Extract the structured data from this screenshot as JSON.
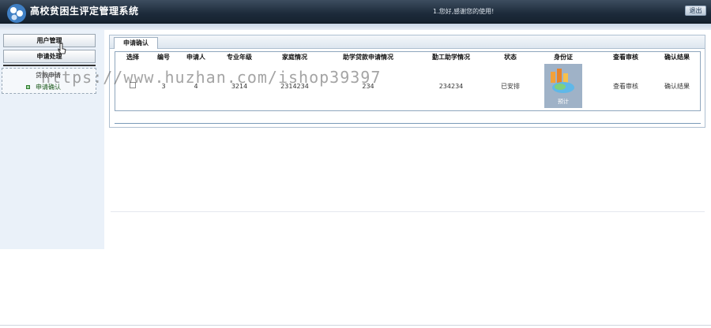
{
  "header": {
    "app_title": "高校贫困生评定管理系统",
    "welcome_text": "1.您好,感谢您的使用!",
    "exit_label": "退出"
  },
  "sidebar": {
    "user_mgmt_label": "用户管理",
    "apply_label": "申请处理",
    "submenu": [
      {
        "label": "贷款申请"
      },
      {
        "label": "申请确认"
      }
    ]
  },
  "panel": {
    "tab_label": "申请确认",
    "columns": [
      "选择",
      "编号",
      "申请人",
      "专业年级",
      "家庭情况",
      "助学贷款申请情况",
      "勤工助学情况",
      "状态",
      "身份证",
      "查看审核",
      "确认结果"
    ],
    "rows": [
      {
        "select": "",
        "id": "3",
        "applicant": "4",
        "major": "3214",
        "family": "2314234",
        "loan": "234",
        "work_study": "234234",
        "status": "已安排",
        "id_card_caption": "预计",
        "review_link": "查看审核",
        "result_link": "确认结果"
      }
    ]
  },
  "watermark": "https://www.huzhan.com/ishop39397"
}
